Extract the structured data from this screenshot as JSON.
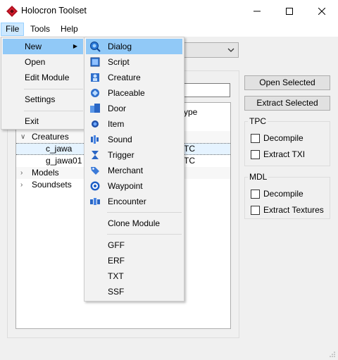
{
  "window": {
    "title": "Holocron Toolset",
    "icons": [
      "app-icon",
      "minimize-icon",
      "maximize-icon",
      "close-icon"
    ]
  },
  "menubar": {
    "file": "File",
    "tools": "Tools",
    "help": "Help"
  },
  "file_menu": {
    "new": "New",
    "open": "Open",
    "edit_module": "Edit Module",
    "settings": "Settings",
    "exit": "Exit"
  },
  "new_menu": {
    "items": [
      {
        "label": "Dialog",
        "icon": "dialog-icon"
      },
      {
        "label": "Script",
        "icon": "script-icon"
      },
      {
        "label": "Creature",
        "icon": "creature-icon"
      },
      {
        "label": "Placeable",
        "icon": "placeable-icon"
      },
      {
        "label": "Door",
        "icon": "door-icon"
      },
      {
        "label": "Item",
        "icon": "item-icon"
      },
      {
        "label": "Sound",
        "icon": "sound-icon"
      },
      {
        "label": "Trigger",
        "icon": "trigger-icon"
      },
      {
        "label": "Merchant",
        "icon": "merchant-icon"
      },
      {
        "label": "Waypoint",
        "icon": "waypoint-icon"
      },
      {
        "label": "Encounter",
        "icon": "encounter-icon"
      }
    ],
    "clone_module": "Clone Module",
    "formats": [
      "GFF",
      "ERF",
      "TXT",
      "SSF"
    ]
  },
  "tree": {
    "header_partial": "ype",
    "rows": [
      {
        "label": "Creatures",
        "expanded": true
      },
      {
        "label": "c_jawa",
        "type": "TC"
      },
      {
        "label": "g_jawa01",
        "type": "TC"
      },
      {
        "label": "Models",
        "expanded": false
      },
      {
        "label": "Soundsets",
        "expanded": false
      }
    ]
  },
  "right_panel": {
    "open_selected": "Open Selected",
    "extract_selected": "Extract Selected",
    "tpc": {
      "title": "TPC",
      "decompile": "Decompile",
      "extract_txi": "Extract TXI"
    },
    "mdl": {
      "title": "MDL",
      "decompile": "Decompile",
      "extract_textures": "Extract Textures"
    }
  },
  "colors": {
    "menu_hover": "#91c9f7",
    "menu_selected_top": "#cce8ff",
    "icon_blue": "#1c5fc4"
  }
}
